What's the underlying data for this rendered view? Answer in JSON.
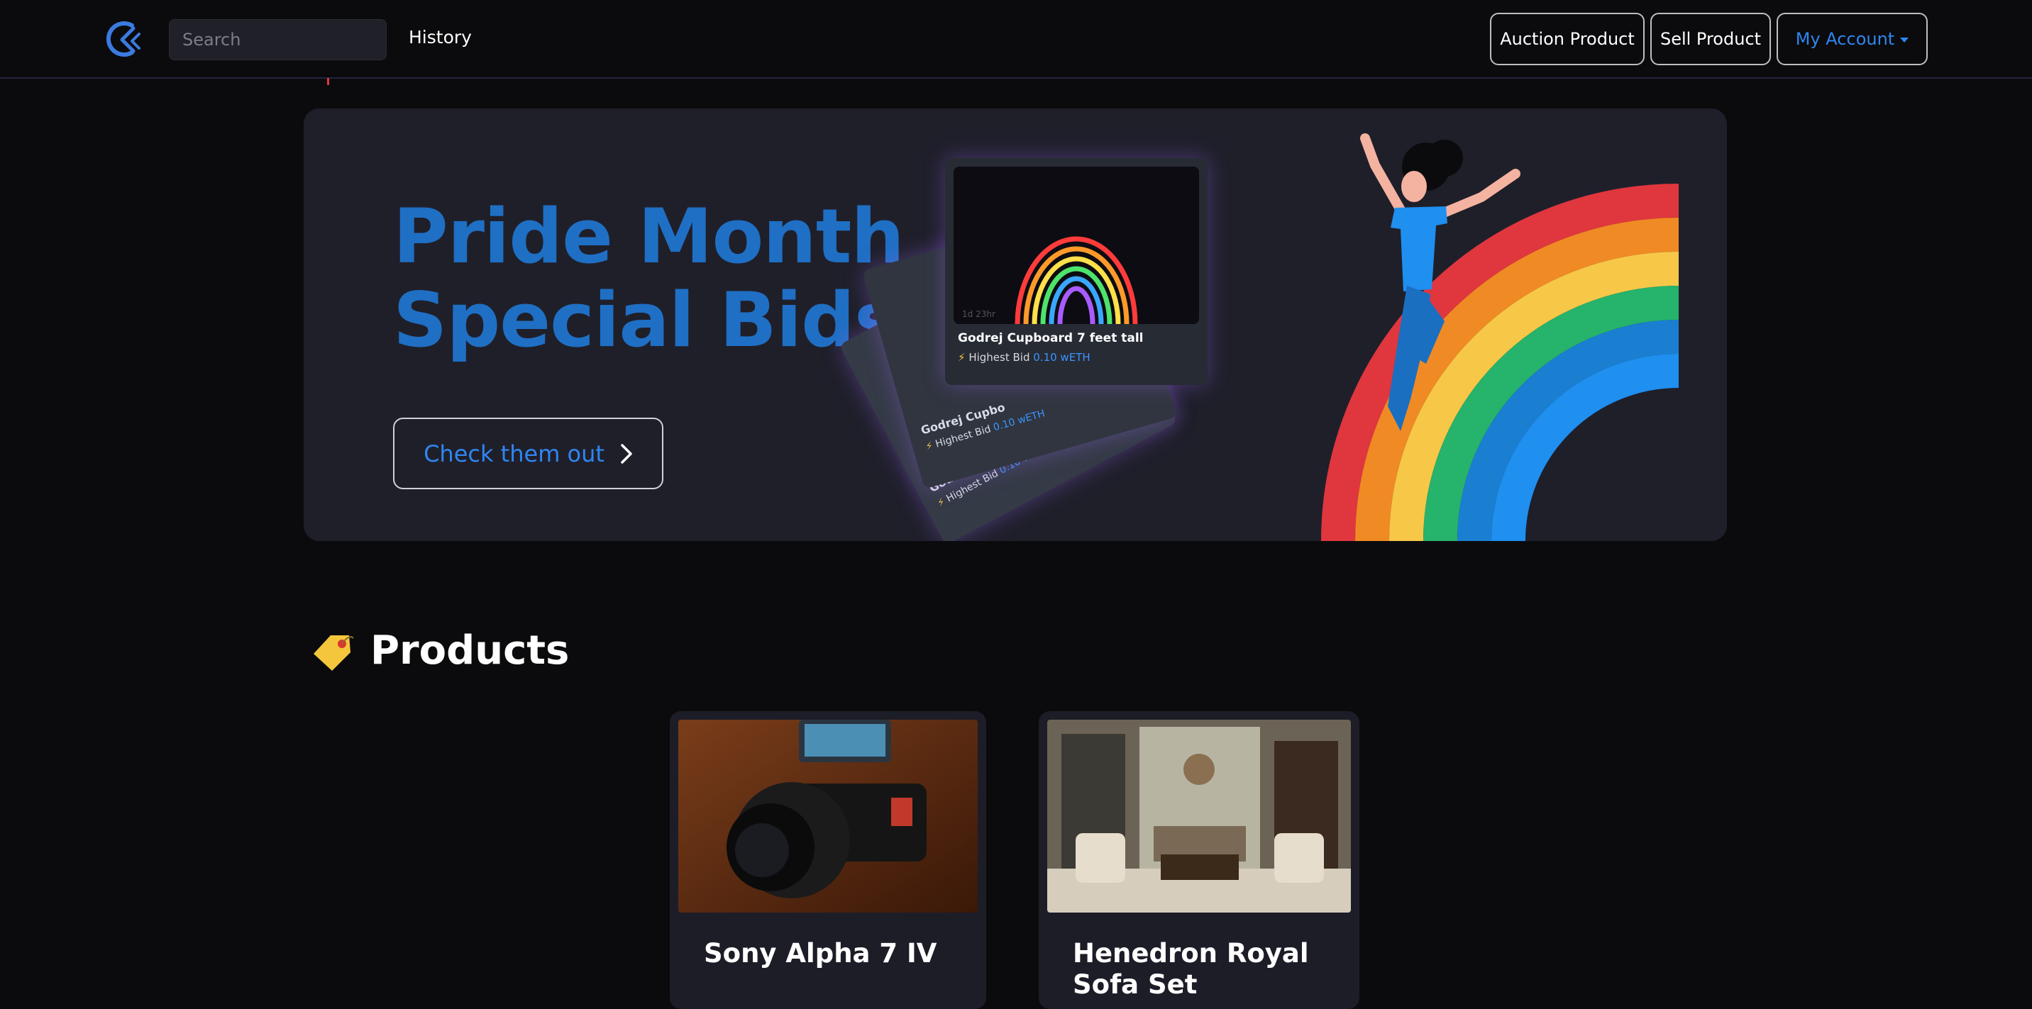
{
  "nav": {
    "search_placeholder": "Search",
    "history_label": "History",
    "auction_label": "Auction Product",
    "sell_label": "Sell Product",
    "account_label": "My Account",
    "logo_icon": "brand-logo-icon",
    "account_caret_icon": "caret-down-icon"
  },
  "banner": {
    "title_line1": "Pride Month",
    "title_line2": "Special Bids",
    "cta_label": "Check them out",
    "cta_icon": "chevron-right-icon",
    "front_card": {
      "title": "Godrej Cupboard 7 feet tall",
      "bid_prefix": "Highest Bid",
      "bid_amount": "0.10 wETH",
      "timer": "1d 23hr"
    },
    "back_cards": [
      {
        "title": "Godrej Cupbo",
        "bid_prefix": "Highest Bid",
        "bid_amount": "0.10 wETH"
      },
      {
        "title": "Godrej Cu",
        "bid_prefix": "Highest Bid",
        "bid_amount": "0.10 wETH"
      }
    ],
    "colors": {
      "title": "#1f6fc4",
      "rainbow": [
        "#e0363e",
        "#f08a24",
        "#f7c748",
        "#26b36b",
        "#1a7fd1",
        "#1f8ff0"
      ]
    }
  },
  "products": {
    "heading": "Products",
    "heading_icon": "price-tag-icon",
    "items": [
      {
        "name": "Sony Alpha 7 IV"
      },
      {
        "name": "Henedron Royal Sofa Set"
      }
    ]
  }
}
